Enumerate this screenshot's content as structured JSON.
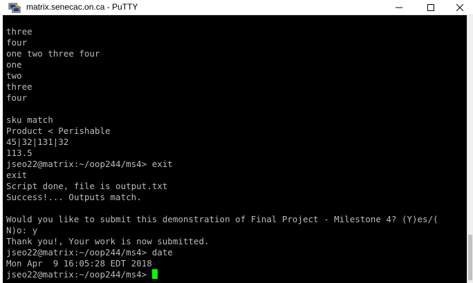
{
  "window": {
    "title": "matrix.senecac.on.ca - PuTTY"
  },
  "terminal": {
    "lines": [
      "three",
      "four",
      "one two three four",
      "one",
      "two",
      "three",
      "four",
      "",
      "sku match",
      "Product < Perishable",
      "45|32|131|32",
      "113.5",
      "jseo22@matrix:~/oop244/ms4> exit",
      "exit",
      "Script done, file is output.txt",
      "Success!... Outputs match.",
      "",
      "Would you like to submit this demonstration of Final Project - Milestone 4? (Y)es/(",
      "N)o: y",
      "Thank you!, Your work is now submitted.",
      "jseo22@matrix:~/oop244/ms4> date",
      "Mon Apr  9 16:05:28 EDT 2018"
    ],
    "prompt": "jseo22@matrix:~/oop244/ms4>",
    "text_color": "#bbbbbb",
    "background_color": "#000000",
    "cursor_color": "#00ff00"
  },
  "icons": {
    "app": "putty-icon",
    "minimize": "minimize-icon",
    "maximize": "maximize-icon",
    "close": "close-icon"
  }
}
